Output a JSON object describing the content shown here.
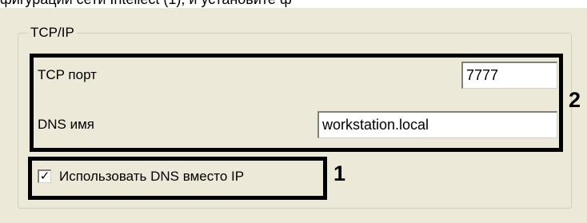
{
  "top_caption": "фигурации сети Intellect (1), и установите ф",
  "group": {
    "title": "TCP/IP"
  },
  "fields": {
    "tcp_port_label": "TCP порт",
    "tcp_port_value": "7777",
    "dns_name_label": "DNS имя",
    "dns_name_value": "workstation.local"
  },
  "checkbox": {
    "label": "Использовать DNS вместо IP",
    "checked": true,
    "check_glyph": "✓"
  },
  "annotations": {
    "callout_1": "1",
    "callout_2": "2"
  }
}
